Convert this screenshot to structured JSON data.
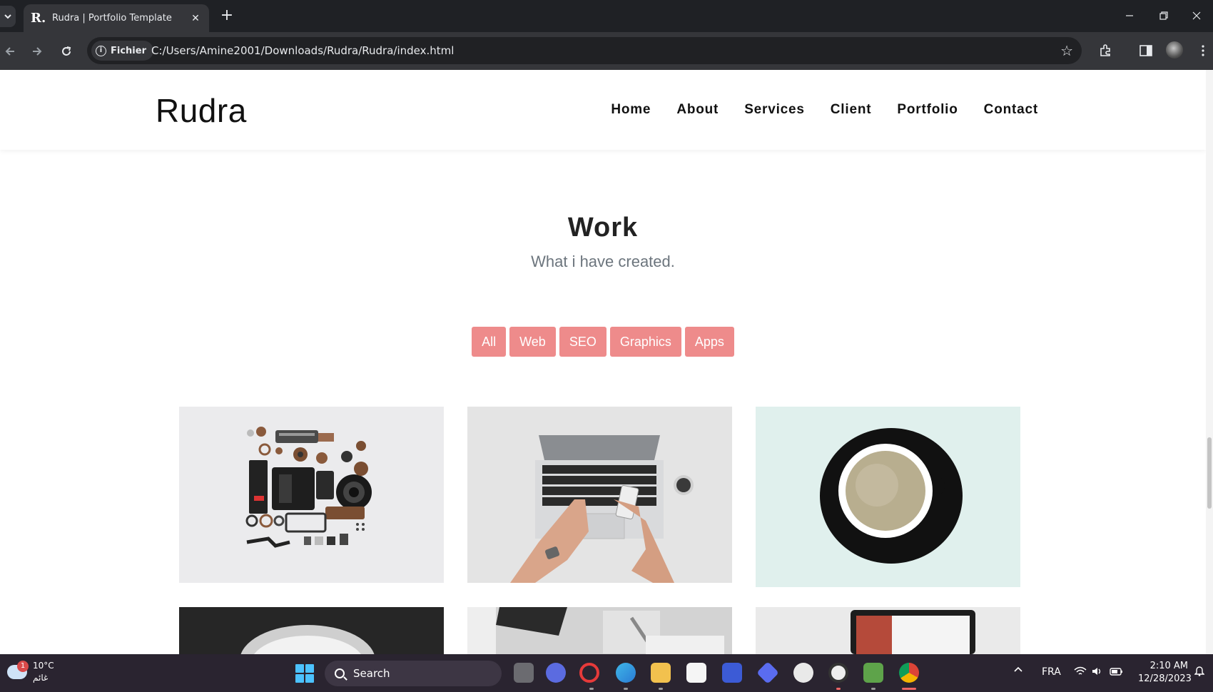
{
  "browser": {
    "tab_title": "Rudra | Portfolio Template",
    "tab_favicon": "R.",
    "tab_close": "✕",
    "new_tab": "+",
    "site_chip": "Fichier",
    "url": "C:/Users/Amine2001/Downloads/Rudra/Rudra/index.html",
    "icons": [
      "back-icon",
      "forward-icon",
      "reload-icon",
      "info-icon",
      "star-icon",
      "extensions-icon",
      "sidebar-icon",
      "profile-avatar",
      "kebab-menu-icon"
    ]
  },
  "site": {
    "logo": "Rudra",
    "nav": [
      "Home",
      "About",
      "Services",
      "Client",
      "Portfolio",
      "Contact"
    ],
    "section_title": "Work",
    "section_subtitle": "What i have created.",
    "filters": [
      "All",
      "Web",
      "SEO",
      "Graphics",
      "Apps"
    ],
    "accent_color": "#ee8b8b",
    "portfolio_images": [
      "camera-parts-flatlay",
      "laptop-hands-phone",
      "coffee-cup",
      "dandelion-monochrome",
      "desk-stationery",
      "laptop-screen"
    ]
  },
  "taskbar": {
    "weather_temp": "10°C",
    "weather_desc": "غائم",
    "notification_count": "1",
    "search_label": "Search",
    "language": "FRA",
    "time": "2:10 AM",
    "date": "12/28/2023"
  }
}
